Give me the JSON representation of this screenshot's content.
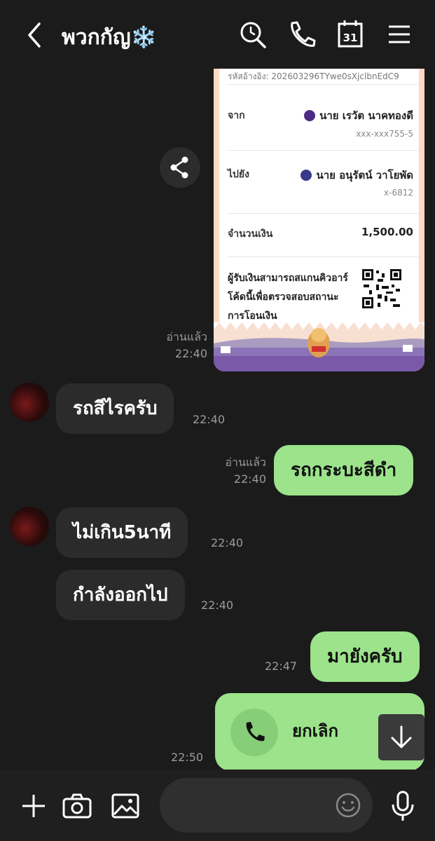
{
  "header": {
    "title": "พวกกัญ❄️"
  },
  "slip": {
    "ref": "รหัสอ้างอิง: 202603296TYwe0sXjclbnEdC9",
    "from_label": "จาก",
    "from_name": "นาย เรวัต นาคทองดี",
    "from_account": "xxx-xxx755-5",
    "to_label": "ไปยัง",
    "to_name": "นาย อนุรัตน์ วาโยพัด",
    "to_account": "x-6812",
    "amount_label": "จำนวนเงิน",
    "amount": "1,500.00",
    "note": "ผู้รับเงินสามารถสแกนคิวอาร์โค้ดนี้เพื่อตรวจสอบสถานะการโอนเงิน",
    "from_bank_color": "#4e2a84",
    "to_bank_color": "#3a3a8a"
  },
  "messages": [
    {
      "read": "อ่านแล้ว",
      "time": "22:40"
    },
    {
      "text": "รถสีไรครับ",
      "time": "22:40"
    },
    {
      "text": "รถกระบะสีดำ",
      "read": "อ่านแล้ว",
      "time": "22:40"
    },
    {
      "text": "ไม่เกิน5นาที",
      "time": "22:40"
    },
    {
      "text": "กำลังออกไป",
      "time": "22:40"
    },
    {
      "text": "มายังครับ",
      "time": "22:47"
    },
    {
      "text": "ยกเลิก",
      "time": "22:50"
    }
  ],
  "colors": {
    "background": "#1b1b1b",
    "outgoing_bubble": "#9ce38b",
    "incoming_bubble": "#2b2b2b"
  }
}
